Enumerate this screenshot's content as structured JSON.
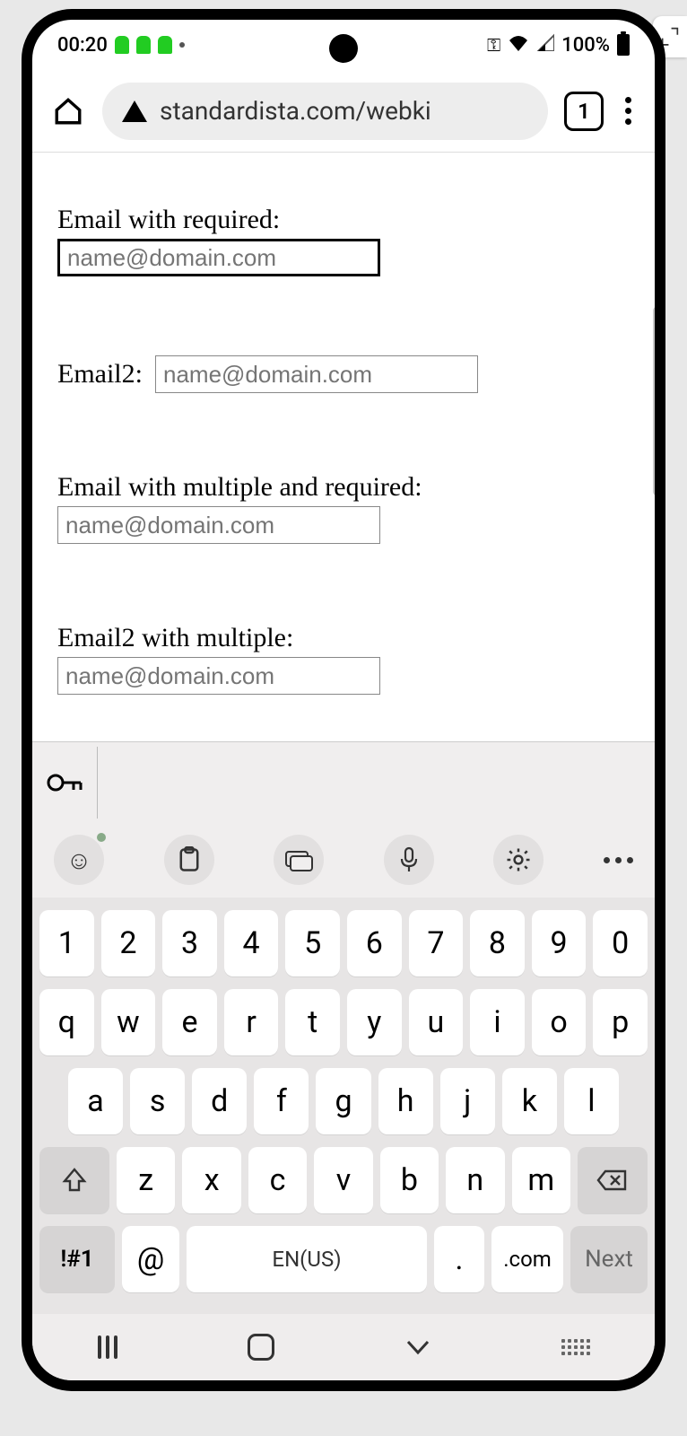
{
  "status": {
    "time": "00:20",
    "battery_pct": "100%"
  },
  "browser": {
    "url": "standardista.com/webki",
    "tab_count": "1"
  },
  "form": {
    "field1": {
      "label": "Email with required:",
      "placeholder": "name@domain.com"
    },
    "field2": {
      "label": "Email2:",
      "placeholder": "name@domain.com"
    },
    "field3": {
      "label": "Email with multiple and required:",
      "placeholder": "name@domain.com"
    },
    "field4": {
      "label": "Email2 with multiple:",
      "placeholder": "name@domain.com"
    }
  },
  "keyboard": {
    "row1": [
      "1",
      "2",
      "3",
      "4",
      "5",
      "6",
      "7",
      "8",
      "9",
      "0"
    ],
    "row2": [
      "q",
      "w",
      "e",
      "r",
      "t",
      "y",
      "u",
      "i",
      "o",
      "p"
    ],
    "row3": [
      "a",
      "s",
      "d",
      "f",
      "g",
      "h",
      "j",
      "k",
      "l"
    ],
    "row4": [
      "z",
      "x",
      "c",
      "v",
      "b",
      "n",
      "m"
    ],
    "sym": "!#1",
    "at": "@",
    "space": "EN(US)",
    "period": ".",
    "com": ".com",
    "next": "Next"
  }
}
